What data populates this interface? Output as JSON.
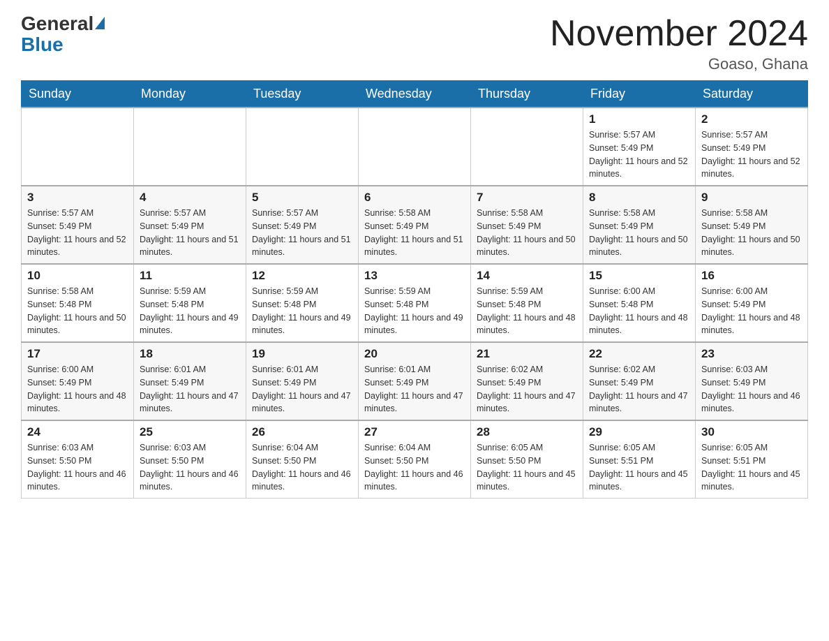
{
  "header": {
    "logo_general": "General",
    "logo_blue": "Blue",
    "month_title": "November 2024",
    "location": "Goaso, Ghana"
  },
  "weekdays": [
    "Sunday",
    "Monday",
    "Tuesday",
    "Wednesday",
    "Thursday",
    "Friday",
    "Saturday"
  ],
  "weeks": [
    [
      {
        "day": "",
        "sunrise": "",
        "sunset": "",
        "daylight": ""
      },
      {
        "day": "",
        "sunrise": "",
        "sunset": "",
        "daylight": ""
      },
      {
        "day": "",
        "sunrise": "",
        "sunset": "",
        "daylight": ""
      },
      {
        "day": "",
        "sunrise": "",
        "sunset": "",
        "daylight": ""
      },
      {
        "day": "",
        "sunrise": "",
        "sunset": "",
        "daylight": ""
      },
      {
        "day": "1",
        "sunrise": "Sunrise: 5:57 AM",
        "sunset": "Sunset: 5:49 PM",
        "daylight": "Daylight: 11 hours and 52 minutes."
      },
      {
        "day": "2",
        "sunrise": "Sunrise: 5:57 AM",
        "sunset": "Sunset: 5:49 PM",
        "daylight": "Daylight: 11 hours and 52 minutes."
      }
    ],
    [
      {
        "day": "3",
        "sunrise": "Sunrise: 5:57 AM",
        "sunset": "Sunset: 5:49 PM",
        "daylight": "Daylight: 11 hours and 52 minutes."
      },
      {
        "day": "4",
        "sunrise": "Sunrise: 5:57 AM",
        "sunset": "Sunset: 5:49 PM",
        "daylight": "Daylight: 11 hours and 51 minutes."
      },
      {
        "day": "5",
        "sunrise": "Sunrise: 5:57 AM",
        "sunset": "Sunset: 5:49 PM",
        "daylight": "Daylight: 11 hours and 51 minutes."
      },
      {
        "day": "6",
        "sunrise": "Sunrise: 5:58 AM",
        "sunset": "Sunset: 5:49 PM",
        "daylight": "Daylight: 11 hours and 51 minutes."
      },
      {
        "day": "7",
        "sunrise": "Sunrise: 5:58 AM",
        "sunset": "Sunset: 5:49 PM",
        "daylight": "Daylight: 11 hours and 50 minutes."
      },
      {
        "day": "8",
        "sunrise": "Sunrise: 5:58 AM",
        "sunset": "Sunset: 5:49 PM",
        "daylight": "Daylight: 11 hours and 50 minutes."
      },
      {
        "day": "9",
        "sunrise": "Sunrise: 5:58 AM",
        "sunset": "Sunset: 5:49 PM",
        "daylight": "Daylight: 11 hours and 50 minutes."
      }
    ],
    [
      {
        "day": "10",
        "sunrise": "Sunrise: 5:58 AM",
        "sunset": "Sunset: 5:48 PM",
        "daylight": "Daylight: 11 hours and 50 minutes."
      },
      {
        "day": "11",
        "sunrise": "Sunrise: 5:59 AM",
        "sunset": "Sunset: 5:48 PM",
        "daylight": "Daylight: 11 hours and 49 minutes."
      },
      {
        "day": "12",
        "sunrise": "Sunrise: 5:59 AM",
        "sunset": "Sunset: 5:48 PM",
        "daylight": "Daylight: 11 hours and 49 minutes."
      },
      {
        "day": "13",
        "sunrise": "Sunrise: 5:59 AM",
        "sunset": "Sunset: 5:48 PM",
        "daylight": "Daylight: 11 hours and 49 minutes."
      },
      {
        "day": "14",
        "sunrise": "Sunrise: 5:59 AM",
        "sunset": "Sunset: 5:48 PM",
        "daylight": "Daylight: 11 hours and 48 minutes."
      },
      {
        "day": "15",
        "sunrise": "Sunrise: 6:00 AM",
        "sunset": "Sunset: 5:48 PM",
        "daylight": "Daylight: 11 hours and 48 minutes."
      },
      {
        "day": "16",
        "sunrise": "Sunrise: 6:00 AM",
        "sunset": "Sunset: 5:49 PM",
        "daylight": "Daylight: 11 hours and 48 minutes."
      }
    ],
    [
      {
        "day": "17",
        "sunrise": "Sunrise: 6:00 AM",
        "sunset": "Sunset: 5:49 PM",
        "daylight": "Daylight: 11 hours and 48 minutes."
      },
      {
        "day": "18",
        "sunrise": "Sunrise: 6:01 AM",
        "sunset": "Sunset: 5:49 PM",
        "daylight": "Daylight: 11 hours and 47 minutes."
      },
      {
        "day": "19",
        "sunrise": "Sunrise: 6:01 AM",
        "sunset": "Sunset: 5:49 PM",
        "daylight": "Daylight: 11 hours and 47 minutes."
      },
      {
        "day": "20",
        "sunrise": "Sunrise: 6:01 AM",
        "sunset": "Sunset: 5:49 PM",
        "daylight": "Daylight: 11 hours and 47 minutes."
      },
      {
        "day": "21",
        "sunrise": "Sunrise: 6:02 AM",
        "sunset": "Sunset: 5:49 PM",
        "daylight": "Daylight: 11 hours and 47 minutes."
      },
      {
        "day": "22",
        "sunrise": "Sunrise: 6:02 AM",
        "sunset": "Sunset: 5:49 PM",
        "daylight": "Daylight: 11 hours and 47 minutes."
      },
      {
        "day": "23",
        "sunrise": "Sunrise: 6:03 AM",
        "sunset": "Sunset: 5:49 PM",
        "daylight": "Daylight: 11 hours and 46 minutes."
      }
    ],
    [
      {
        "day": "24",
        "sunrise": "Sunrise: 6:03 AM",
        "sunset": "Sunset: 5:50 PM",
        "daylight": "Daylight: 11 hours and 46 minutes."
      },
      {
        "day": "25",
        "sunrise": "Sunrise: 6:03 AM",
        "sunset": "Sunset: 5:50 PM",
        "daylight": "Daylight: 11 hours and 46 minutes."
      },
      {
        "day": "26",
        "sunrise": "Sunrise: 6:04 AM",
        "sunset": "Sunset: 5:50 PM",
        "daylight": "Daylight: 11 hours and 46 minutes."
      },
      {
        "day": "27",
        "sunrise": "Sunrise: 6:04 AM",
        "sunset": "Sunset: 5:50 PM",
        "daylight": "Daylight: 11 hours and 46 minutes."
      },
      {
        "day": "28",
        "sunrise": "Sunrise: 6:05 AM",
        "sunset": "Sunset: 5:50 PM",
        "daylight": "Daylight: 11 hours and 45 minutes."
      },
      {
        "day": "29",
        "sunrise": "Sunrise: 6:05 AM",
        "sunset": "Sunset: 5:51 PM",
        "daylight": "Daylight: 11 hours and 45 minutes."
      },
      {
        "day": "30",
        "sunrise": "Sunrise: 6:05 AM",
        "sunset": "Sunset: 5:51 PM",
        "daylight": "Daylight: 11 hours and 45 minutes."
      }
    ]
  ]
}
